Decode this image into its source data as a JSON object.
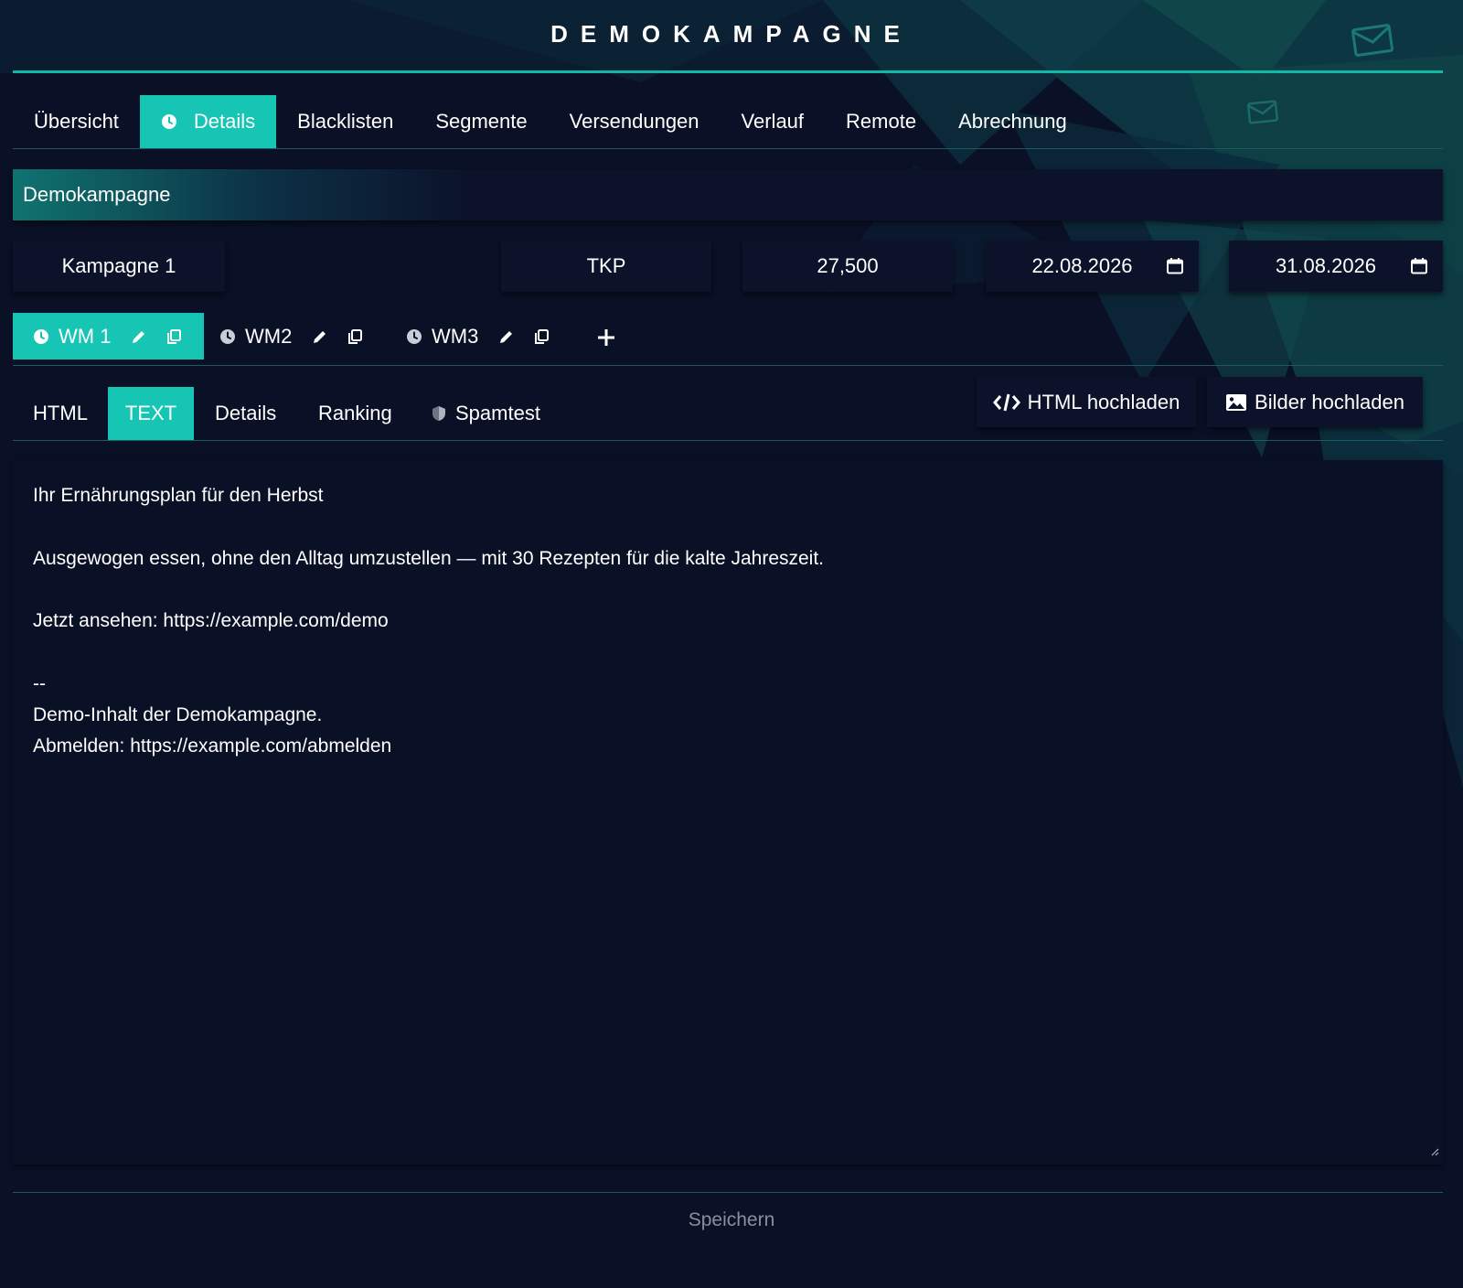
{
  "app": {
    "title": "DEMOKAMPAGNE"
  },
  "main_tabs": [
    {
      "label": "Übersicht",
      "active": false
    },
    {
      "label": "Details",
      "active": true,
      "icon": "clock-icon"
    },
    {
      "label": "Blacklisten",
      "active": false
    },
    {
      "label": "Segmente",
      "active": false
    },
    {
      "label": "Versendungen",
      "active": false
    },
    {
      "label": "Verlauf",
      "active": false
    },
    {
      "label": "Remote",
      "active": false
    },
    {
      "label": "Abrechnung",
      "active": false
    }
  ],
  "campaign": {
    "name": "Demokampagne"
  },
  "fields": {
    "name": "Kampagne 1",
    "type": "TKP",
    "price": "27,500",
    "start_date": "22.08.2026",
    "end_date": "31.08.2026"
  },
  "mailings": [
    {
      "label": "WM 1",
      "active": true
    },
    {
      "label": "WM2",
      "active": false
    },
    {
      "label": "WM3",
      "active": false
    }
  ],
  "content_tabs": [
    {
      "label": "HTML",
      "active": false
    },
    {
      "label": "TEXT",
      "active": true
    },
    {
      "label": "Details",
      "active": false
    },
    {
      "label": "Ranking",
      "active": false
    },
    {
      "label": "Spamtest",
      "active": false,
      "icon": "shield-icon"
    }
  ],
  "buttons": {
    "html_upload": "HTML hochladen",
    "images_upload": "Bilder hochladen",
    "save": "Speichern"
  },
  "editor_lines": [
    "Ihr Ernährungsplan für den Herbst",
    "",
    "Ausgewogen essen, ohne den Alltag umzustellen — mit 30 Rezepten für die kalte Jahreszeit.",
    "",
    "Jetzt ansehen: https://example.com/demo",
    "",
    "",
    "--",
    "Demo-Inhalt der Demokampagne.",
    "Abmelden: https://example.com/abmelden"
  ],
  "colors": {
    "accent": "#16c5b3",
    "background": "#0a1026",
    "panel": "#0b1229",
    "muted": "#8a8f9c"
  }
}
